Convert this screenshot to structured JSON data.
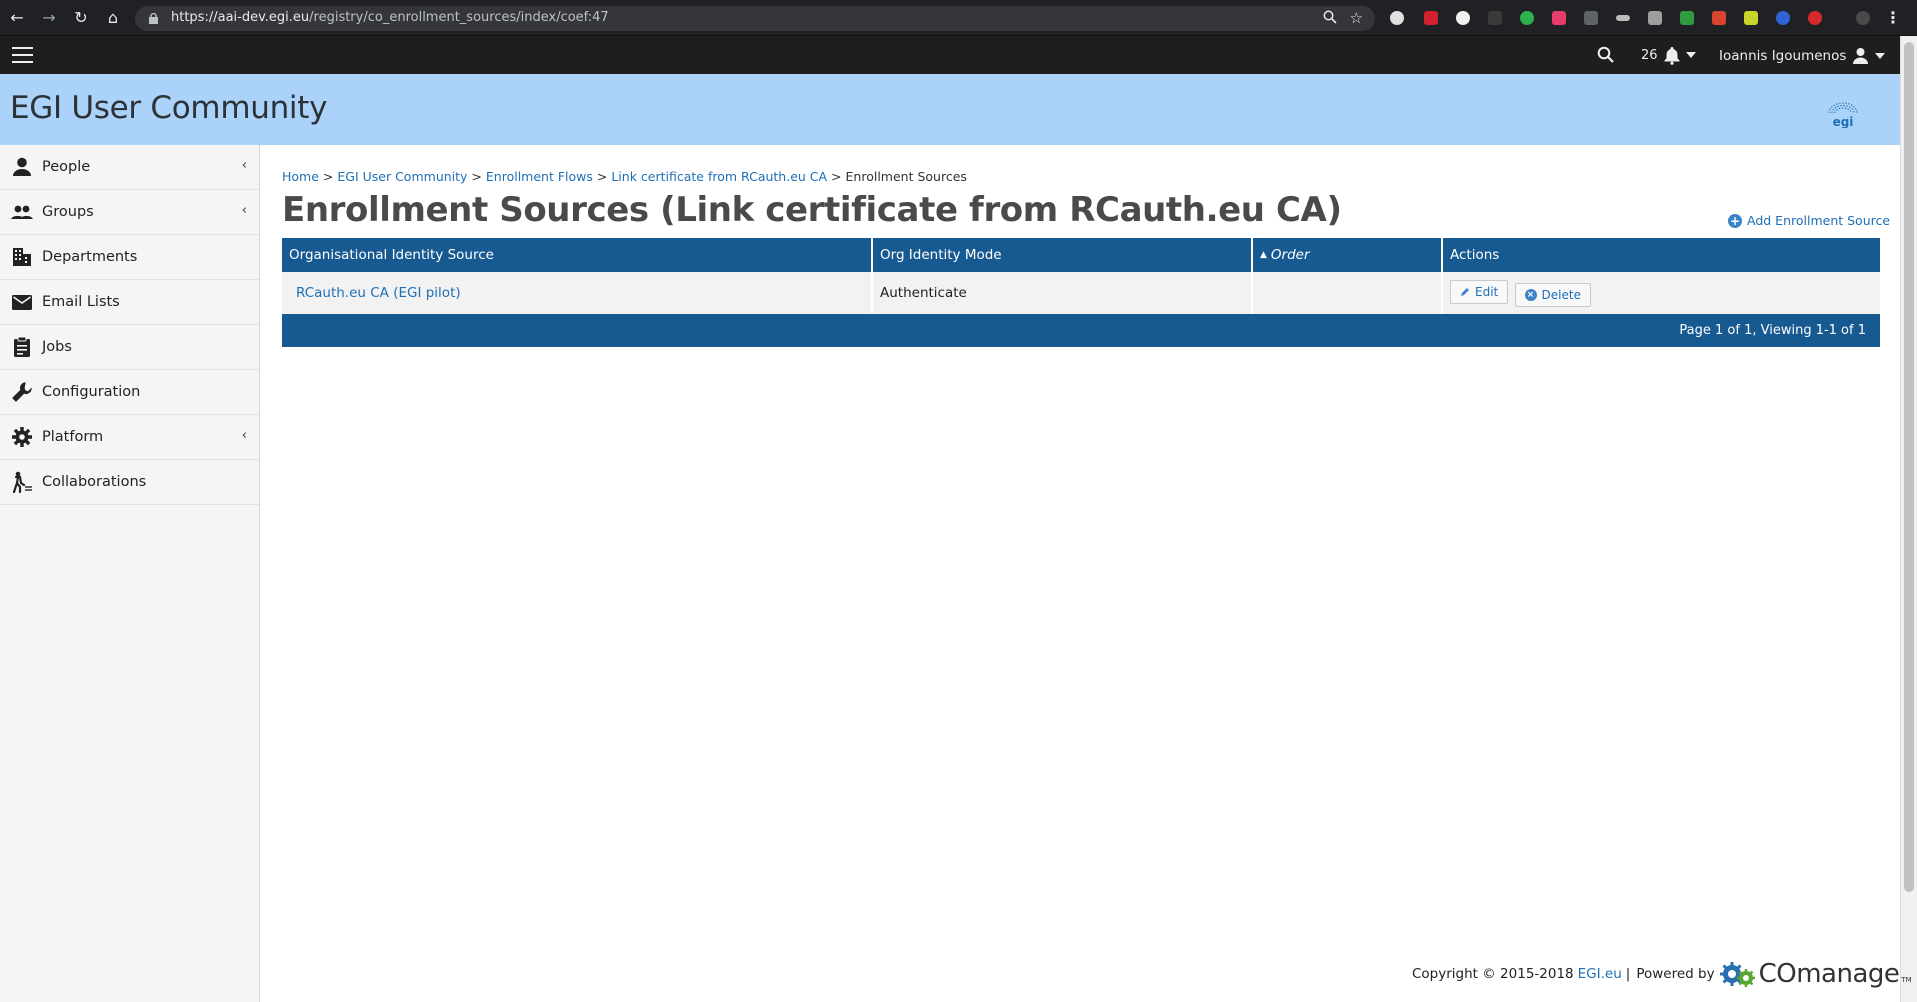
{
  "browser": {
    "url_host": "https://aai-dev.egi.eu",
    "url_path": "/registry/co_enrollment_sources/index/coef:47"
  },
  "topbar": {
    "notification_count": "26",
    "user_name": "Ioannis Igoumenos"
  },
  "banner": {
    "title": "EGI User Community",
    "logo_text": "egi"
  },
  "sidebar": {
    "items": [
      {
        "label": "People",
        "icon": "person-icon",
        "has_chevron": true
      },
      {
        "label": "Groups",
        "icon": "group-icon",
        "has_chevron": true
      },
      {
        "label": "Departments",
        "icon": "building-icon",
        "has_chevron": false
      },
      {
        "label": "Email Lists",
        "icon": "envelope-icon",
        "has_chevron": false
      },
      {
        "label": "Jobs",
        "icon": "clipboard-icon",
        "has_chevron": false
      },
      {
        "label": "Configuration",
        "icon": "wrench-icon",
        "has_chevron": false
      },
      {
        "label": "Platform",
        "icon": "gear-icon",
        "has_chevron": true
      },
      {
        "label": "Collaborations",
        "icon": "collaboration-icon",
        "has_chevron": false
      }
    ]
  },
  "breadcrumb": {
    "home": "Home",
    "community": "EGI User Community",
    "flows": "Enrollment Flows",
    "flow": "Link certificate from RCauth.eu CA",
    "current": "Enrollment Sources",
    "separator": ">"
  },
  "main": {
    "title": "Enrollment Sources (Link certificate from RCauth.eu CA)",
    "add_label": "Add Enrollment Source",
    "table": {
      "headers": [
        "Organisational Identity Source",
        "Org Identity Mode",
        "Order",
        "Actions"
      ],
      "rows": [
        {
          "source": "RCauth.eu CA (EGI pilot)",
          "mode": "Authenticate",
          "order": "",
          "edit_label": "Edit",
          "delete_label": "Delete"
        }
      ]
    },
    "pagination": "Page 1 of 1, Viewing 1-1 of 1"
  },
  "footer": {
    "copyright": "Copyright © 2015-2018",
    "egi_link": "EGI.eu",
    "separator": "|",
    "powered_by": "Powered by",
    "comanage": "COmanage",
    "tm": "TM"
  },
  "colors": {
    "banner": "#abd2f8",
    "table_header": "#175a92",
    "link": "#1f6fb6",
    "topbar": "#1e1e1e"
  }
}
